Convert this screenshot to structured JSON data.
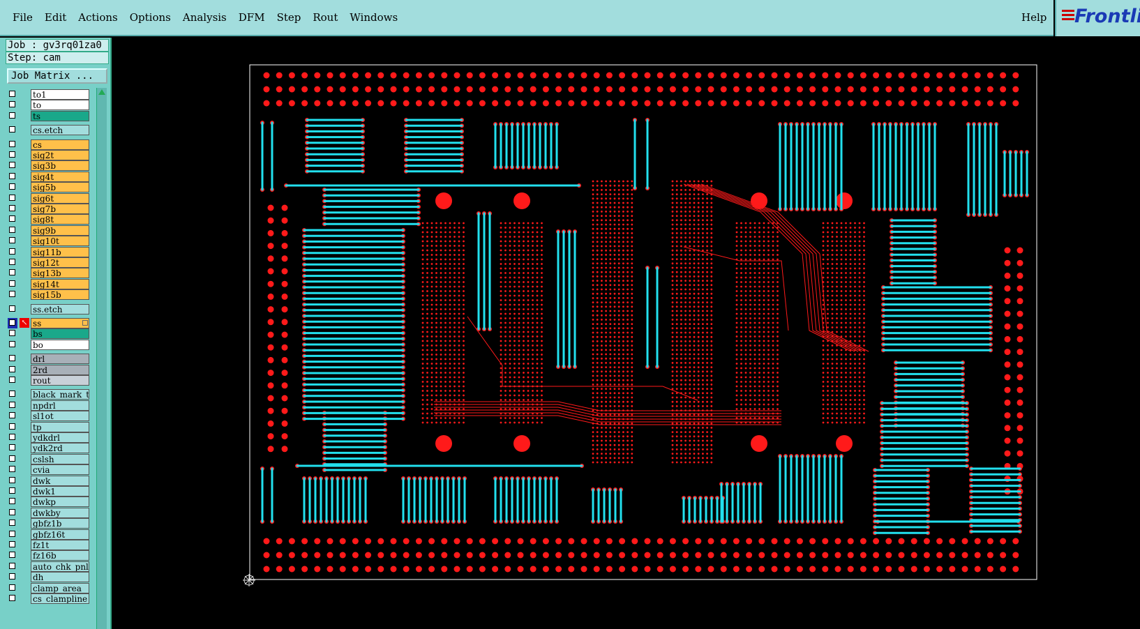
{
  "menubar": {
    "items": [
      "File",
      "Edit",
      "Actions",
      "Options",
      "Analysis",
      "DFM",
      "Step",
      "Rout",
      "Windows"
    ],
    "help": "Help"
  },
  "logo": {
    "text": "Frontli"
  },
  "job": {
    "label": "Job : gv3rq01za0",
    "step": "Step: cam"
  },
  "job_matrix_label": "Job Matrix ...",
  "layers": [
    {
      "name": "to1",
      "color": "#ffffff"
    },
    {
      "name": "to",
      "color": "#ffffff"
    },
    {
      "name": "ts",
      "color": "#1aa88a"
    },
    {
      "name": "cs.etch",
      "color": "#a2dddd"
    },
    {
      "name": "cs",
      "color": "#ffc04a"
    },
    {
      "name": "sig2t",
      "color": "#ffc04a"
    },
    {
      "name": "sig3b",
      "color": "#ffc04a"
    },
    {
      "name": "sig4t",
      "color": "#ffc04a"
    },
    {
      "name": "sig5b",
      "color": "#ffc04a"
    },
    {
      "name": "sig6t",
      "color": "#ffc04a"
    },
    {
      "name": "sig7b",
      "color": "#ffc04a"
    },
    {
      "name": "sig8t",
      "color": "#ffc04a"
    },
    {
      "name": "sig9b",
      "color": "#ffc04a"
    },
    {
      "name": "sig10t",
      "color": "#ffc04a"
    },
    {
      "name": "sig11b",
      "color": "#ffc04a"
    },
    {
      "name": "sig12t",
      "color": "#ffc04a"
    },
    {
      "name": "sig13b",
      "color": "#ffc04a"
    },
    {
      "name": "sig14t",
      "color": "#ffc04a"
    },
    {
      "name": "sig15b",
      "color": "#ffc04a"
    },
    {
      "name": "ss.etch",
      "color": "#a2dddd"
    },
    {
      "name": "ss",
      "color": "#ffc04a",
      "active": true
    },
    {
      "name": "bs",
      "color": "#1aa88a"
    },
    {
      "name": "bo",
      "color": "#ffffff"
    },
    {
      "name": "drl",
      "color": "#a8b0b8"
    },
    {
      "name": "2rd",
      "color": "#a8b0b8"
    },
    {
      "name": "rout",
      "color": "#c8d0d8"
    },
    {
      "name": "black_mark_t",
      "color": "#a2dddd"
    },
    {
      "name": "npdrl",
      "color": "#a2dddd"
    },
    {
      "name": "sl1ot",
      "color": "#a2dddd"
    },
    {
      "name": "tp",
      "color": "#a2dddd"
    },
    {
      "name": "ydkdrl",
      "color": "#a2dddd"
    },
    {
      "name": "ydk2rd",
      "color": "#a2dddd"
    },
    {
      "name": "cslsh",
      "color": "#a2dddd"
    },
    {
      "name": "cvia",
      "color": "#a2dddd"
    },
    {
      "name": "dwk",
      "color": "#a2dddd"
    },
    {
      "name": "dwk1",
      "color": "#a2dddd"
    },
    {
      "name": "dwkp",
      "color": "#a2dddd"
    },
    {
      "name": "dwkby",
      "color": "#a2dddd"
    },
    {
      "name": "gbfz1b",
      "color": "#a2dddd"
    },
    {
      "name": "gbfz16t",
      "color": "#a2dddd"
    },
    {
      "name": "fz1t",
      "color": "#a2dddd"
    },
    {
      "name": "fz16b",
      "color": "#a2dddd"
    },
    {
      "name": "auto_chk_pnl",
      "color": "#a2dddd"
    },
    {
      "name": "dh",
      "color": "#a2dddd"
    },
    {
      "name": "clamp_area",
      "color": "#a2dddd"
    },
    {
      "name": "cs_clampline",
      "color": "#a2dddd"
    }
  ],
  "colors": {
    "pad": "#ff1a1a",
    "trace": "#22e0ee",
    "board_outline": "#ffffff",
    "background": "#000000"
  }
}
